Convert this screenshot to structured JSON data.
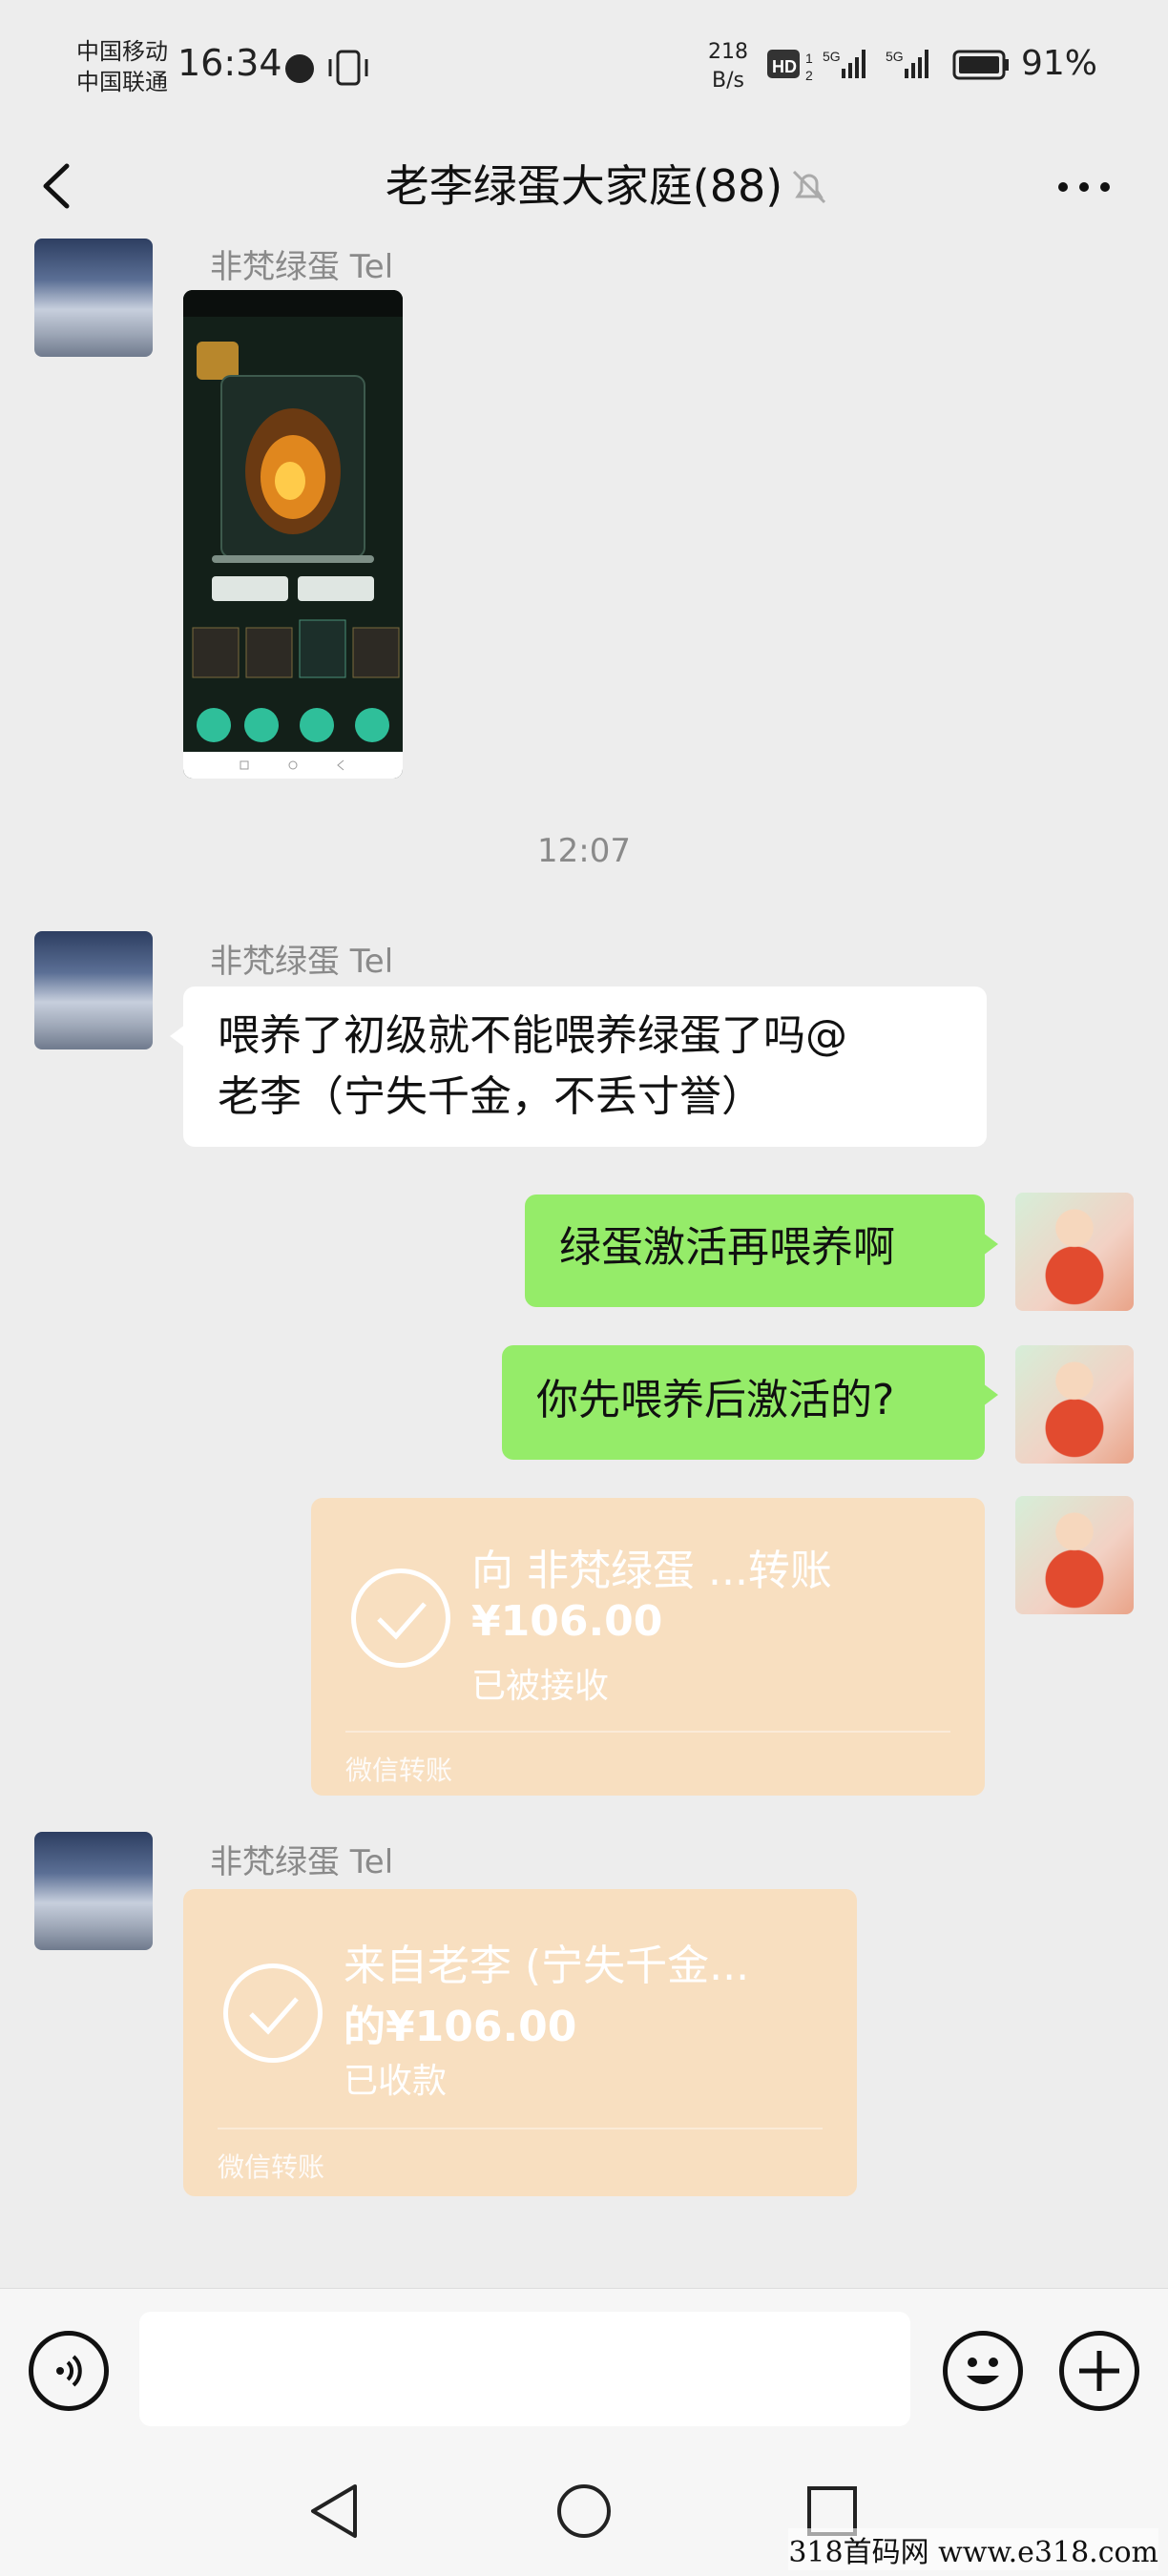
{
  "status_bar": {
    "carrier1": "中国移动",
    "carrier2": "中国联通",
    "time": "16:34",
    "net_speed_value": "218",
    "net_speed_unit": "B/s",
    "battery": "91%"
  },
  "header": {
    "title": "老李绿蛋大家庭(88)"
  },
  "messages": [
    {
      "sender": "非梵绿蛋 Tel",
      "type": "image"
    },
    {
      "type": "timestamp",
      "text": "12:07"
    },
    {
      "sender": "非梵绿蛋 Tel",
      "type": "text",
      "line1": "喂养了初级就不能喂养绿蛋了吗@",
      "line2": "老李（宁失千金，不丢寸誉）"
    },
    {
      "type": "text_out",
      "text": "绿蛋激活再喂养啊"
    },
    {
      "type": "text_out",
      "text": "你先喂养后激活的?"
    },
    {
      "type": "transfer_out",
      "line1": "向  非梵绿蛋 ...转账",
      "amount": "¥106.00",
      "status": "已被接收",
      "footer": "微信转账"
    },
    {
      "sender": "非梵绿蛋 Tel",
      "type": "transfer_in",
      "line1": "来自老李 (宁失千金...",
      "amount": "的¥106.00",
      "status": "已收款",
      "footer": "微信转账"
    }
  ],
  "watermark": "318首码网  www.e318.com",
  "icons": [
    "back-icon",
    "mute-bell-icon",
    "more-icon",
    "voice-icon",
    "emoji-icon",
    "plus-icon",
    "nav-back-icon",
    "nav-home-icon",
    "nav-recents-icon"
  ]
}
